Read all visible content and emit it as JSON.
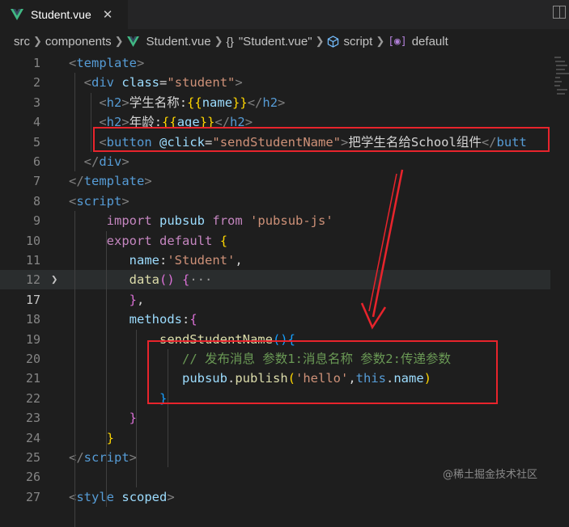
{
  "tab": {
    "title": "Student.vue",
    "close_glyph": "✕",
    "icon": "vue-logo-icon"
  },
  "breadcrumb": {
    "items": [
      {
        "label": "src",
        "icon": ""
      },
      {
        "label": "components",
        "icon": ""
      },
      {
        "label": "Student.vue",
        "icon": "vue-logo-icon"
      },
      {
        "label": "\"Student.vue\"",
        "icon": "braces-icon"
      },
      {
        "label": "script",
        "icon": "cube-icon"
      },
      {
        "label": "default",
        "icon": "bracket-icon"
      }
    ]
  },
  "lines": [
    {
      "num": "1",
      "tokens": [
        [
          "t-tag",
          "<"
        ],
        [
          "t-name",
          "template"
        ],
        [
          "t-tag",
          ">"
        ]
      ]
    },
    {
      "num": "2",
      "tokens": [
        [
          "t-text",
          "  "
        ],
        [
          "t-tag",
          "<"
        ],
        [
          "t-name",
          "div"
        ],
        [
          "t-text",
          " "
        ],
        [
          "t-attr",
          "class"
        ],
        [
          "t-text",
          "="
        ],
        [
          "t-str",
          "\"student\""
        ],
        [
          "t-tag",
          ">"
        ]
      ]
    },
    {
      "num": "3",
      "tokens": [
        [
          "t-text",
          "    "
        ],
        [
          "t-tag",
          "<"
        ],
        [
          "t-name",
          "h2"
        ],
        [
          "t-tag",
          ">"
        ],
        [
          "t-text",
          "学生名称:"
        ],
        [
          "t-brace",
          "{{"
        ],
        [
          "t-var",
          "name"
        ],
        [
          "t-brace",
          "}}"
        ],
        [
          "t-tag",
          "</"
        ],
        [
          "t-name",
          "h2"
        ],
        [
          "t-tag",
          ">"
        ]
      ]
    },
    {
      "num": "4",
      "tokens": [
        [
          "t-text",
          "    "
        ],
        [
          "t-tag",
          "<"
        ],
        [
          "t-name",
          "h2"
        ],
        [
          "t-tag",
          ">"
        ],
        [
          "t-text",
          "年龄:"
        ],
        [
          "t-brace",
          "{{"
        ],
        [
          "t-var",
          "age"
        ],
        [
          "t-brace",
          "}}"
        ],
        [
          "t-tag",
          "</"
        ],
        [
          "t-name",
          "h2"
        ],
        [
          "t-tag",
          ">"
        ]
      ]
    },
    {
      "num": "5",
      "tokens": [
        [
          "t-text",
          "    "
        ],
        [
          "t-tag",
          "<"
        ],
        [
          "t-name",
          "button"
        ],
        [
          "t-text",
          " "
        ],
        [
          "t-attr",
          "@click"
        ],
        [
          "t-text",
          "="
        ],
        [
          "t-str",
          "\"sendStudentName\""
        ],
        [
          "t-tag",
          ">"
        ],
        [
          "t-text",
          "把学生名给School组件"
        ],
        [
          "t-tag",
          "</"
        ],
        [
          "t-name",
          "butt"
        ]
      ]
    },
    {
      "num": "6",
      "tokens": [
        [
          "t-text",
          "  "
        ],
        [
          "t-tag",
          "</"
        ],
        [
          "t-name",
          "div"
        ],
        [
          "t-tag",
          ">"
        ]
      ]
    },
    {
      "num": "7",
      "tokens": [
        [
          "t-tag",
          "</"
        ],
        [
          "t-name",
          "template"
        ],
        [
          "t-tag",
          ">"
        ]
      ]
    },
    {
      "num": "8",
      "tokens": [
        [
          "t-tag",
          "<"
        ],
        [
          "t-name",
          "script"
        ],
        [
          "t-tag",
          ">"
        ]
      ]
    },
    {
      "num": "9",
      "tokens": [
        [
          "t-text",
          "     "
        ],
        [
          "t-kw",
          "import"
        ],
        [
          "t-text",
          " "
        ],
        [
          "t-var",
          "pubsub"
        ],
        [
          "t-text",
          " "
        ],
        [
          "t-kw",
          "from"
        ],
        [
          "t-text",
          " "
        ],
        [
          "t-str",
          "'pubsub-js'"
        ]
      ]
    },
    {
      "num": "10",
      "tokens": [
        [
          "t-text",
          "     "
        ],
        [
          "t-kw",
          "export"
        ],
        [
          "t-text",
          " "
        ],
        [
          "t-kw",
          "default"
        ],
        [
          "t-text",
          " "
        ],
        [
          "t-brace",
          "{"
        ]
      ]
    },
    {
      "num": "11",
      "tokens": [
        [
          "t-text",
          "        "
        ],
        [
          "t-key",
          "name"
        ],
        [
          "t-text",
          ":"
        ],
        [
          "t-str",
          "'Student'"
        ],
        [
          "t-text",
          ","
        ]
      ]
    },
    {
      "num": "12",
      "tokens": [
        [
          "t-text",
          "        "
        ],
        [
          "t-fn",
          "data"
        ],
        [
          "t-paren",
          "()"
        ],
        [
          "t-text",
          " "
        ],
        [
          "t-paren",
          "{"
        ],
        [
          "t-fold",
          "···"
        ]
      ]
    },
    {
      "num": "17",
      "tokens": [
        [
          "t-text",
          "        "
        ],
        [
          "t-paren",
          "}"
        ],
        [
          "t-text",
          ","
        ]
      ]
    },
    {
      "num": "18",
      "tokens": [
        [
          "t-text",
          "        "
        ],
        [
          "t-key",
          "methods"
        ],
        [
          "t-text",
          ":"
        ],
        [
          "t-paren",
          "{"
        ]
      ]
    },
    {
      "num": "19",
      "tokens": [
        [
          "t-text",
          "            "
        ],
        [
          "t-fn",
          "sendStudentName"
        ],
        [
          "t-bracket",
          "()"
        ],
        [
          "t-bracket",
          "{"
        ]
      ]
    },
    {
      "num": "20",
      "tokens": [
        [
          "t-text",
          "               "
        ],
        [
          "t-comment",
          "// 发布消息 参数1:消息名称 参数2:传递参数"
        ]
      ]
    },
    {
      "num": "21",
      "tokens": [
        [
          "t-text",
          "               "
        ],
        [
          "t-var",
          "pubsub"
        ],
        [
          "t-text",
          "."
        ],
        [
          "t-fn",
          "publish"
        ],
        [
          "t-brace",
          "("
        ],
        [
          "t-str",
          "'hello'"
        ],
        [
          "t-text",
          ","
        ],
        [
          "t-this",
          "this"
        ],
        [
          "t-text",
          "."
        ],
        [
          "t-var",
          "name"
        ],
        [
          "t-brace",
          ")"
        ]
      ]
    },
    {
      "num": "22",
      "tokens": [
        [
          "t-text",
          "            "
        ],
        [
          "t-bracket",
          "}"
        ]
      ]
    },
    {
      "num": "23",
      "tokens": [
        [
          "t-text",
          "        "
        ],
        [
          "t-paren",
          "}"
        ]
      ]
    },
    {
      "num": "24",
      "tokens": [
        [
          "t-text",
          "     "
        ],
        [
          "t-brace",
          "}"
        ]
      ]
    },
    {
      "num": "25",
      "tokens": [
        [
          "t-tag",
          "</"
        ],
        [
          "t-name",
          "script"
        ],
        [
          "t-tag",
          ">"
        ]
      ]
    },
    {
      "num": "26",
      "tokens": []
    },
    {
      "num": "27",
      "tokens": [
        [
          "t-tag",
          "<"
        ],
        [
          "t-name",
          "style"
        ],
        [
          "t-text",
          " "
        ],
        [
          "t-attr",
          "scoped"
        ],
        [
          "t-tag",
          ">"
        ]
      ]
    }
  ],
  "watermark": "@稀土掘金技术社区",
  "colors": {
    "highlight_box": "#e8242c",
    "arrow": "#e8242c",
    "background": "#1e1e1e"
  }
}
